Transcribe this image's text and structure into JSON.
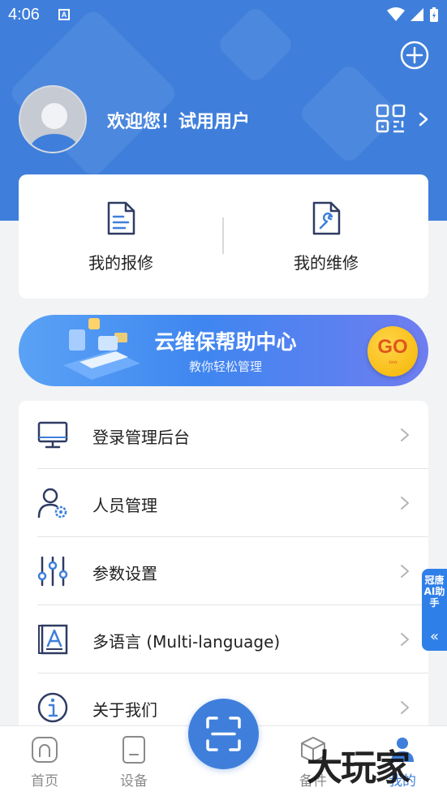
{
  "status_bar": {
    "time": "4:06"
  },
  "header": {
    "welcome_text": "欢迎您！试用用户",
    "add_icon": "plus-circle-icon",
    "qr_icon": "qr-code-icon"
  },
  "quick_actions": [
    {
      "label": "我的报修",
      "icon": "document-icon"
    },
    {
      "label": "我的维修",
      "icon": "document-wrench-icon"
    }
  ],
  "banner": {
    "title": "云维保帮助中心",
    "subtitle": "教你轻松管理",
    "go_label": "GO",
    "go_arrows": "››››"
  },
  "menu": [
    {
      "label": "登录管理后台",
      "icon": "monitor-icon"
    },
    {
      "label": "人员管理",
      "icon": "user-gear-icon"
    },
    {
      "label": "参数设置",
      "icon": "sliders-icon"
    },
    {
      "label": "多语言 (Multi-language)",
      "icon": "language-book-icon"
    },
    {
      "label": "关于我们",
      "icon": "info-icon"
    }
  ],
  "side_tab": {
    "label": "冠唐AI助手",
    "arrow": "«"
  },
  "tabbar": {
    "items": [
      {
        "label": "首页",
        "icon": "home-icon"
      },
      {
        "label": "设备",
        "icon": "device-icon"
      },
      {
        "label": "备件",
        "icon": "box-icon"
      },
      {
        "label": "我的",
        "icon": "profile-icon"
      }
    ],
    "active_index": 3,
    "scan_icon": "scan-icon"
  },
  "watermark": "大玩家",
  "colors": {
    "primary": "#3f7fdb",
    "background": "#f2f3f5",
    "icon_dark": "#2f3b63",
    "go_yellow": "#f5b400",
    "side_tab": "#2f7fe8"
  }
}
